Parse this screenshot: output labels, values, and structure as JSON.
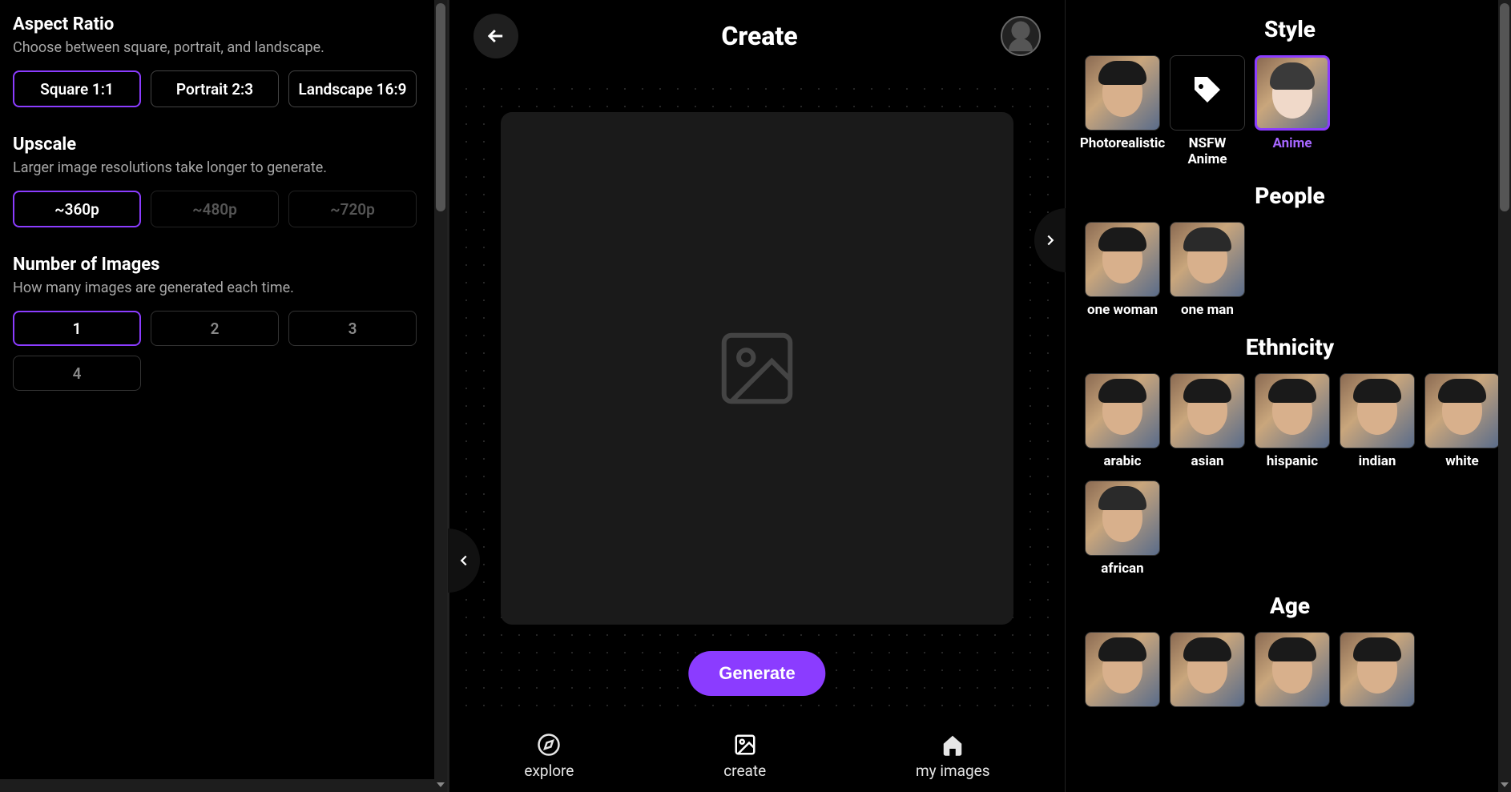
{
  "left": {
    "aspect": {
      "title": "Aspect Ratio",
      "desc": "Choose between square, portrait, and landscape.",
      "options": [
        "Square 1:1",
        "Portrait 2:3",
        "Landscape 16:9"
      ],
      "selected": 0
    },
    "upscale": {
      "title": "Upscale",
      "desc": "Larger image resolutions take longer to generate.",
      "options": [
        "~360p",
        "~480p",
        "~720p"
      ],
      "selected": 0
    },
    "num": {
      "title": "Number of Images",
      "desc": "How many images are generated each time.",
      "options": [
        "1",
        "2",
        "3",
        "4"
      ],
      "selected": 0
    }
  },
  "center": {
    "title": "Create",
    "generate": "Generate",
    "nav": {
      "explore": "explore",
      "create": "create",
      "myimages": "my images"
    }
  },
  "right": {
    "style": {
      "title": "Style",
      "items": [
        {
          "label": "Photorealistic",
          "selected": false,
          "thumb": "face"
        },
        {
          "label": "NSFW Anime",
          "selected": false,
          "thumb": "tag-icon"
        },
        {
          "label": "Anime",
          "selected": true,
          "thumb": "anime"
        }
      ]
    },
    "people": {
      "title": "People",
      "items": [
        {
          "label": "one woman",
          "thumb": "face"
        },
        {
          "label": "one man",
          "thumb": "man"
        }
      ]
    },
    "ethnicity": {
      "title": "Ethnicity",
      "items": [
        {
          "label": "arabic",
          "thumb": "face"
        },
        {
          "label": "asian",
          "thumb": "face"
        },
        {
          "label": "hispanic",
          "thumb": "face"
        },
        {
          "label": "indian",
          "thumb": "face"
        },
        {
          "label": "white",
          "thumb": "face"
        },
        {
          "label": "african",
          "thumb": "man"
        }
      ]
    },
    "age": {
      "title": "Age",
      "items": [
        {
          "label": "",
          "thumb": "face"
        },
        {
          "label": "",
          "thumb": "face"
        },
        {
          "label": "",
          "thumb": "face"
        },
        {
          "label": "",
          "thumb": "face"
        }
      ]
    }
  }
}
